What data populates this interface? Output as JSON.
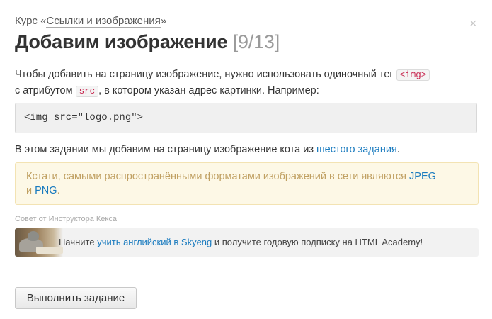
{
  "header": {
    "course_prefix": "Курс «",
    "course_link": "Ссылки и изображения",
    "course_suffix": "»",
    "close_icon": "close-icon",
    "close_glyph": "×"
  },
  "task": {
    "title": "Добавим изображение",
    "counter": "[9/13]"
  },
  "intro": {
    "text1": "Чтобы добавить на страницу изображение, нужно использовать одиночный тег ",
    "code1": "<img>",
    "text2": "с атрибутом ",
    "code2": "src",
    "text3": ", в котором указан адрес картинки. Например:"
  },
  "code_example": "<img src=\"logo.png\">",
  "assignment": {
    "text": "В этом задании мы добавим на страницу изображение кота из ",
    "link": "шестого задания",
    "end": "."
  },
  "note": {
    "text1": "Кстати, самыми распространёнными форматами изображений в сети являются ",
    "link1": "JPEG",
    "text2": "и ",
    "link2": "PNG",
    "end": "."
  },
  "tip": {
    "label": "Совет от Инструктора Кекса",
    "text1": "Начните ",
    "link": "учить английский в Skyeng",
    "text2": " и получите годовую подписку на HTML Academy!"
  },
  "actions": {
    "submit_label": "Выполнить задание"
  }
}
